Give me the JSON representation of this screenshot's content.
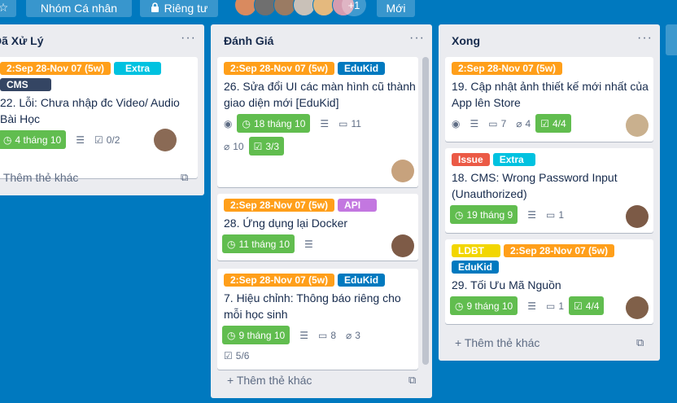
{
  "header": {
    "star_icon": "star-icon",
    "team_label": "Nhóm Cá nhân",
    "private_label": "Riêng tư",
    "lock_icon": "lock-icon",
    "extra_members": "+1",
    "new_label": "Mới"
  },
  "lists": [
    {
      "title": "Đã Xử Lý",
      "menu": "···",
      "add_card": "+ Thêm thẻ khác",
      "cards": [
        {
          "labels": [
            "2:Sep 28-Nov 07 (5w)",
            "Extra",
            "CMS"
          ],
          "title_lines": [
            "22. Lỗi: Chưa nhập đc Video/ Audio",
            "Bài Học"
          ],
          "due": "4 tháng 10",
          "checklist": "0/2"
        }
      ]
    },
    {
      "title": "Đánh Giá",
      "menu": "···",
      "add_card": "+ Thêm thẻ khác",
      "cards": [
        {
          "labels": [
            "2:Sep 28-Nov 07 (5w)",
            "EduKid"
          ],
          "title_lines": [
            "26. Sửa đổi UI các màn hình cũ thành",
            "giao diện mới [EduKid]"
          ],
          "due": "18 tháng 10",
          "comments": "11",
          "attachments": "10",
          "checklist": "3/3"
        },
        {
          "labels": [
            "2:Sep 28-Nov 07 (5w)",
            "API"
          ],
          "title_lines": [
            "28. Ứng dụng lại Docker"
          ],
          "due": "11 tháng 10"
        },
        {
          "labels": [
            "2:Sep 28-Nov 07 (5w)",
            "EduKid"
          ],
          "title_lines": [
            "7. Hiệu chỉnh: Thông báo riêng cho",
            "mỗi học sinh"
          ],
          "due": "9 tháng 10",
          "comments": "8",
          "attachments": "3",
          "checklist": "5/6"
        }
      ]
    },
    {
      "title": "Xong",
      "menu": "···",
      "add_card": "+ Thêm thẻ khác",
      "cards": [
        {
          "labels": [
            "2:Sep 28-Nov 07 (5w)"
          ],
          "title_lines": [
            "19. Cập nhật ảnh thiết kế mới nhất của",
            "App lên Store"
          ],
          "comments": "7",
          "attachments": "4",
          "checklist": "4/4"
        },
        {
          "labels": [
            "Issue",
            "Extra"
          ],
          "title_lines": [
            "18. CMS: Wrong Password Input",
            "(Unauthorized)"
          ],
          "due": "19 tháng 9",
          "comments": "1"
        },
        {
          "labels": [
            "LDBT",
            "2:Sep 28-Nov 07 (5w)",
            "EduKid"
          ],
          "title_lines": [
            "29. Tối Ưu Mã Nguồn"
          ],
          "due": "9 tháng 10",
          "comments": "1",
          "checklist": "4/4"
        }
      ]
    }
  ],
  "colors": {
    "board": "#0079bf",
    "green": "#61bd4f",
    "orange": "#ff9f1a",
    "sky": "#00c2e0",
    "navy": "#344563",
    "blue": "#0079bf",
    "purple": "#c377e0",
    "red": "#eb5a46",
    "yellow": "#f2d600"
  }
}
